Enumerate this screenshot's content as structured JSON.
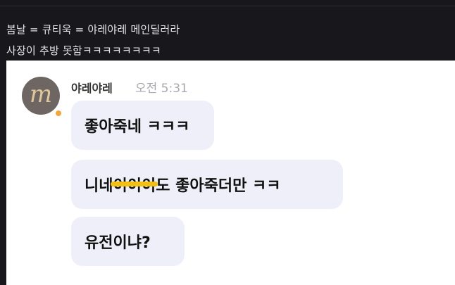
{
  "post": {
    "line1": "봄날 =  큐티욱 = 야레야레 메인딜러라",
    "line2": "사장이 추방 못함ㅋㅋㅋㅋㅋㅋㅋㅋ"
  },
  "chat": {
    "avatar_letter": "m",
    "sender": "야레야레",
    "time": "오전 5:31",
    "bubble1": "좋아죽네 ㅋㅋㅋ",
    "bubble2_before": "니네 ",
    "bubble2_struck": "이이이",
    "bubble2_after": "도 좋아죽더만 ㅋㅋ",
    "bubble3": "유전이냐?"
  },
  "colors": {
    "page_bg": "#17171c",
    "bubble_bg": "#eeeff8",
    "marker": "#f2c014",
    "status_dot": "#f3a43a"
  }
}
